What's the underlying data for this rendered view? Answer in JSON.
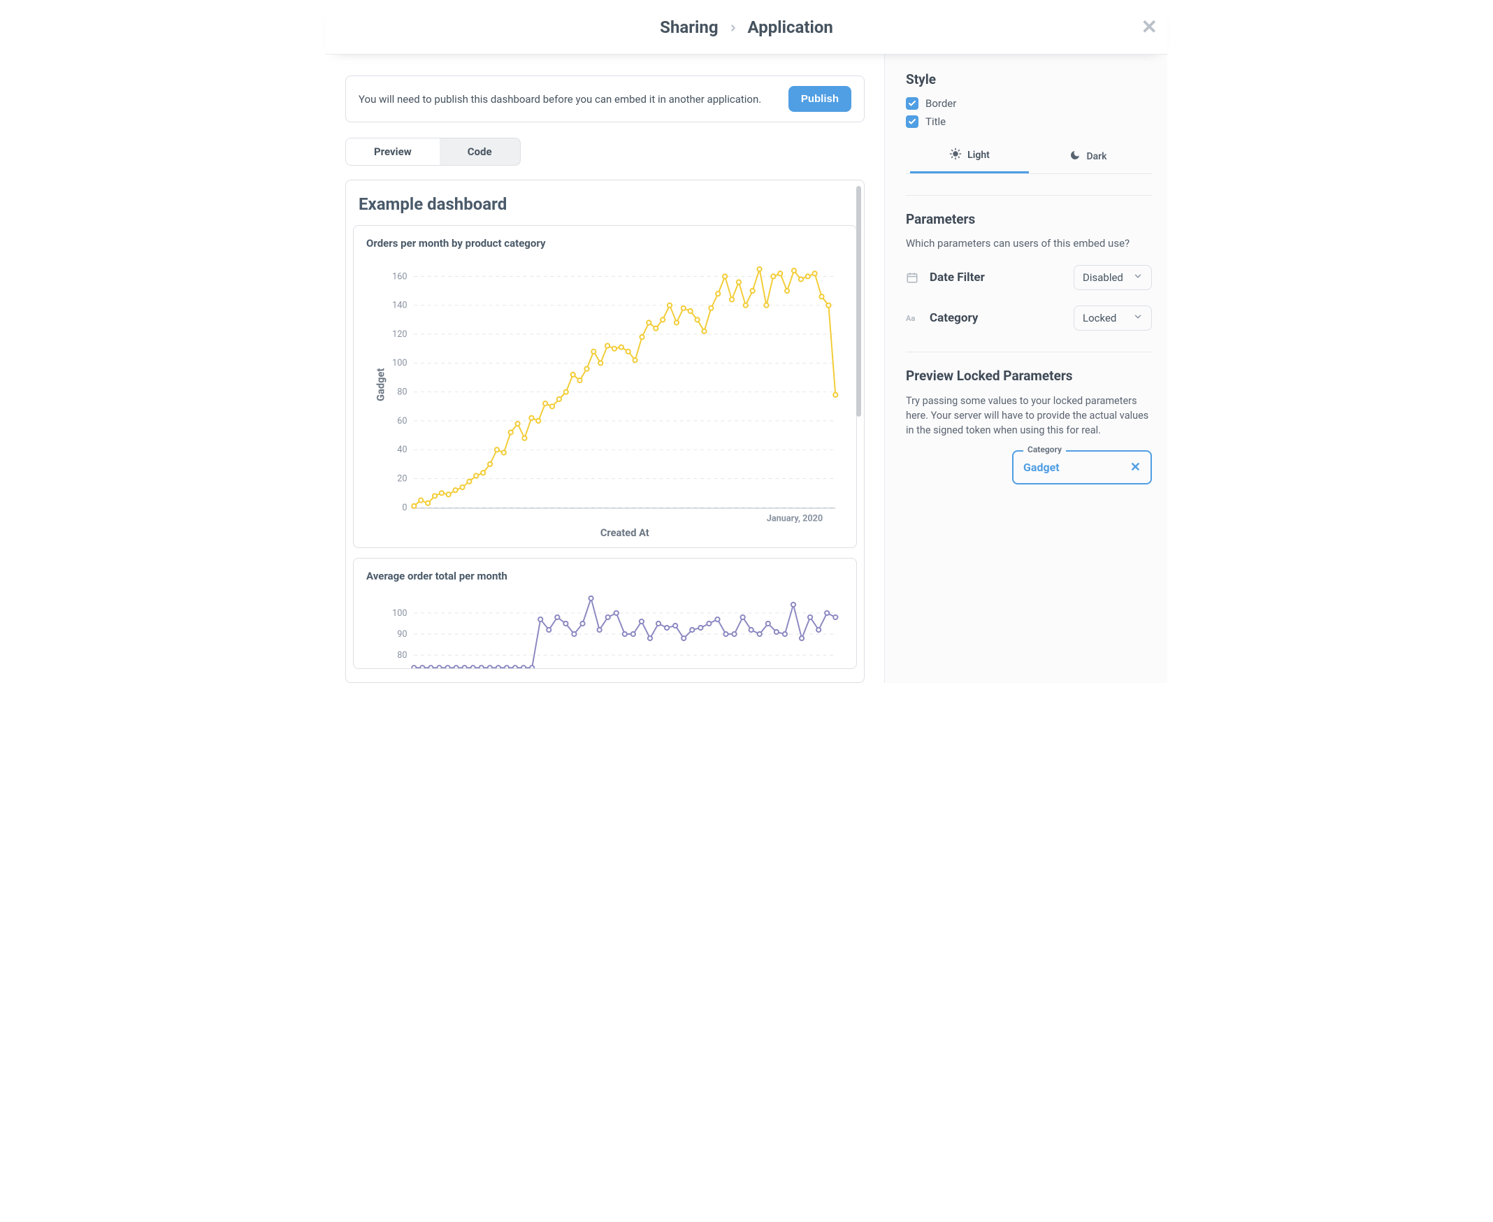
{
  "header": {
    "breadcrumb_root": "Sharing",
    "breadcrumb_current": "Application"
  },
  "banner": {
    "message": "You will need to publish this dashboard before you can embed it in another application.",
    "publish_label": "Publish"
  },
  "tabs": {
    "preview_label": "Preview",
    "code_label": "Code",
    "active": "Preview"
  },
  "dashboard": {
    "title": "Example dashboard",
    "charts": [
      {
        "title": "Orders per month by product category",
        "ylabel": "Gadget",
        "xlabel": "Created At",
        "annotation": "January, 2020"
      },
      {
        "title": "Average order total per month"
      }
    ]
  },
  "chart_data": [
    {
      "type": "line",
      "title": "Orders per month by product category",
      "ylabel": "Gadget",
      "xlabel": "Created At",
      "ylim": [
        0,
        170
      ],
      "y_ticks": [
        0,
        20,
        40,
        60,
        80,
        100,
        120,
        140,
        160
      ],
      "color": "#f2cc35",
      "values": [
        1,
        5,
        3,
        8,
        10,
        9,
        12,
        14,
        18,
        22,
        24,
        30,
        40,
        38,
        52,
        58,
        48,
        62,
        60,
        72,
        70,
        75,
        80,
        92,
        88,
        96,
        108,
        100,
        112,
        110,
        111,
        108,
        102,
        118,
        128,
        124,
        130,
        140,
        128,
        138,
        136,
        130,
        122,
        138,
        148,
        160,
        144,
        156,
        140,
        150,
        165,
        140,
        160,
        162,
        150,
        164,
        158,
        160,
        162,
        146,
        140,
        78
      ],
      "annotation": {
        "text": "January, 2020",
        "x_fraction": 0.97
      }
    },
    {
      "type": "line",
      "title": "Average order total per month",
      "ylim": [
        75,
        110
      ],
      "y_ticks": [
        80,
        90,
        100
      ],
      "color": "#8b88c1",
      "values": [
        74,
        74,
        74,
        74,
        74,
        74,
        74,
        74,
        74,
        74,
        74,
        74,
        74,
        74,
        74,
        97,
        92,
        98,
        95,
        90,
        95,
        107,
        92,
        98,
        100,
        90,
        90,
        96,
        88,
        95,
        93,
        94,
        88,
        92,
        93,
        95,
        97,
        90,
        90,
        98,
        92,
        90,
        95,
        91,
        90,
        104,
        88,
        98,
        92,
        100,
        98
      ]
    }
  ],
  "style_panel": {
    "heading": "Style",
    "border_label": "Border",
    "title_label": "Title",
    "border_checked": true,
    "title_checked": true,
    "theme": {
      "light_label": "Light",
      "dark_label": "Dark",
      "active": "Light"
    }
  },
  "parameters_panel": {
    "heading": "Parameters",
    "description": "Which parameters can users of this embed use?",
    "items": [
      {
        "icon": "calendar",
        "name": "Date Filter",
        "value": "Disabled"
      },
      {
        "icon": "text",
        "name": "Category",
        "value": "Locked"
      }
    ]
  },
  "preview_locked": {
    "heading": "Preview Locked Parameters",
    "description": "Try passing some values to your locked parameters here. Your server will have to provide the actual values in the signed token when using this for real.",
    "field_label": "Category",
    "field_value": "Gadget"
  }
}
